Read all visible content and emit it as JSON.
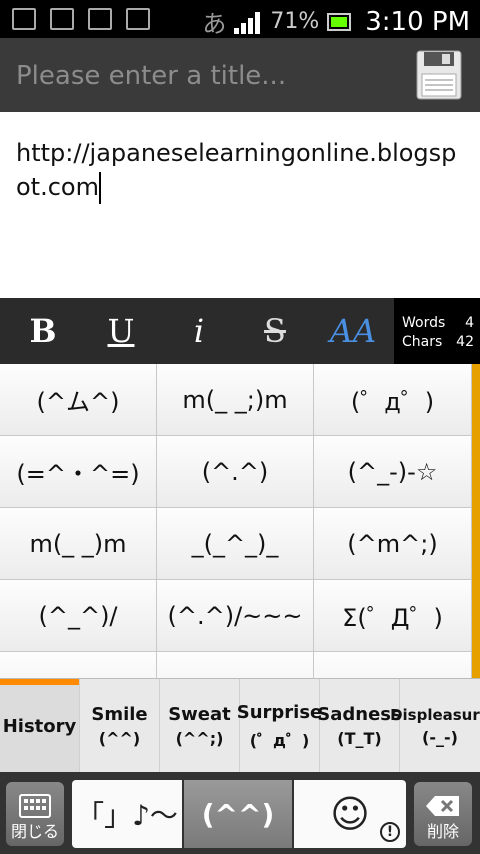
{
  "status_bar": {
    "input_method": "あ",
    "battery": "71%",
    "time": "3:10 PM"
  },
  "title_bar": {
    "title_placeholder": "Please enter a title...",
    "title_value": ""
  },
  "editor": {
    "content": "http://japaneselearningonline.blogspot.com"
  },
  "format_toolbar": {
    "bold": "B",
    "underline": "U",
    "italic": "i",
    "strikethrough": "S",
    "font_style": "AA",
    "words_label": "Words",
    "words_value": "4",
    "chars_label": "Chars",
    "chars_value": "42"
  },
  "emoticons": [
    [
      "(^ム^)",
      "m(_ _;)m",
      "(゜д゜)"
    ],
    [
      "(=^・^=)",
      "(^.^)",
      "(^_-)-☆"
    ],
    [
      "m(_ _)m",
      "_(_^_)_",
      "(^m^;)"
    ],
    [
      "(^_^)/",
      "(^.^)/~~~",
      "Σ(゜Д゜)"
    ]
  ],
  "categories": [
    {
      "label": "History",
      "emoticon": ""
    },
    {
      "label": "Smile",
      "emoticon": "(^^)"
    },
    {
      "label": "Sweat",
      "emoticon": "(^^;)"
    },
    {
      "label": "Surprise",
      "emoticon": "(゜д゜)"
    },
    {
      "label": "Sadness",
      "emoticon": "(T_T)"
    },
    {
      "label": "Displeasure",
      "emoticon": "(-_-)"
    }
  ],
  "bottom_bar": {
    "close_label": "閉じる",
    "tab_symbols": "「」♪〜",
    "tab_emoticons": "(^^)",
    "tab_emoji": "☺",
    "delete_label": "削除"
  },
  "colors": {
    "accent": "#ff8a00",
    "scroll": "#e6a100",
    "titlebar": "#3a3a3a"
  }
}
